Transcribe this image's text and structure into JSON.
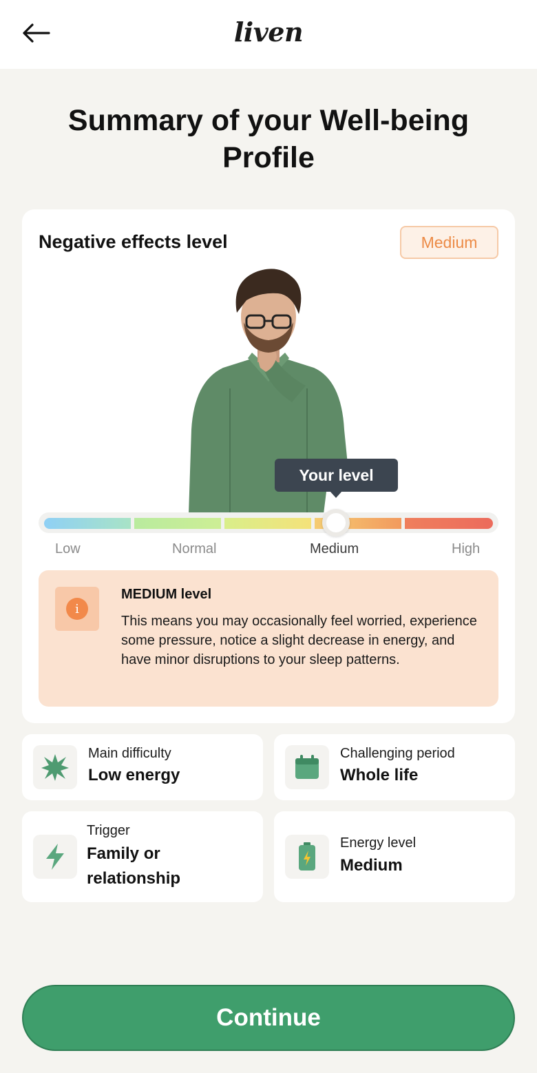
{
  "header": {
    "back_icon": "arrow-left-icon",
    "logo": "liven"
  },
  "title": "Summary of your Well-being Profile",
  "effects_card": {
    "title": "Negative effects level",
    "badge": "Medium",
    "badge_color": "#ec8a45",
    "tooltip": "Your level",
    "scale": {
      "labels": [
        "Low",
        "Normal",
        "Medium",
        "High"
      ],
      "selected": "Medium",
      "position": 0.65
    },
    "info": {
      "icon": "info-icon",
      "heading": "MEDIUM level",
      "text": "This means you may occasionally feel worried, experience some pressure, notice a slight decrease in energy, and have minor disruptions to your sleep patterns."
    }
  },
  "stats": [
    {
      "icon": "burst-icon",
      "label": "Main difficulty",
      "value": "Low energy"
    },
    {
      "icon": "calendar-icon",
      "label": "Challenging period",
      "value": "Whole life"
    },
    {
      "icon": "lightning-icon",
      "label": "Trigger",
      "value": "Family or relationship"
    },
    {
      "icon": "battery-icon",
      "label": "Energy level",
      "value": "Medium"
    }
  ],
  "continue_label": "Continue",
  "colors": {
    "accent_green": "#3f9e6c",
    "icon_green": "#5aa77e",
    "background": "#f5f4f0"
  }
}
